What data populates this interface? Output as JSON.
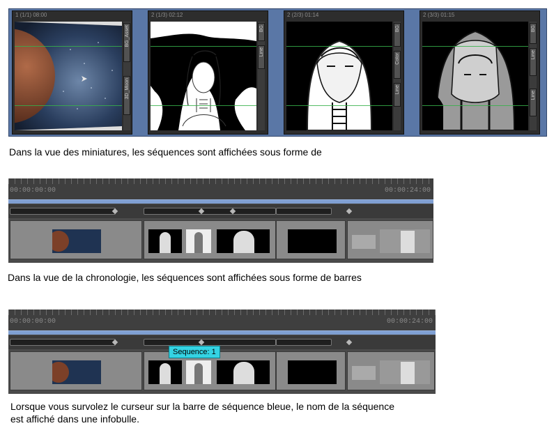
{
  "thumbnails": {
    "panels": [
      {
        "title": "1 (1/1) 08:00",
        "side_tabs": [
          "BG_Asset",
          "3D_Moon"
        ]
      },
      {
        "title": "2 (1/3) 02:12",
        "side_tabs": [
          "BG",
          "Line"
        ]
      },
      {
        "title": "2 (2/3) 01:14",
        "side_tabs": [
          "BG",
          "Color",
          "Line"
        ]
      },
      {
        "title": "2 (3/3) 01:15",
        "side_tabs": [
          "BG",
          "Line",
          "Line"
        ]
      }
    ]
  },
  "captions": {
    "thumbnails": "Dans la vue des miniatures, les séquences sont affichées sous forme de",
    "timeline": "Dans la vue de la chronologie, les séquences sont affichées sous forme de barres",
    "tooltip": "Lorsque vous survolez le curseur sur la barre de séquence bleue, le nom de la séquence est affiché dans une infobulle."
  },
  "timeline": {
    "start_tc": "00:00:00:00",
    "end_tc": "00:00:24:00",
    "tooltip_label": "Sequence: 1"
  },
  "colors": {
    "thumb_background": "#5a77a6",
    "blue_bar": "#7f9fd2",
    "tooltip": "#34d3e3"
  }
}
